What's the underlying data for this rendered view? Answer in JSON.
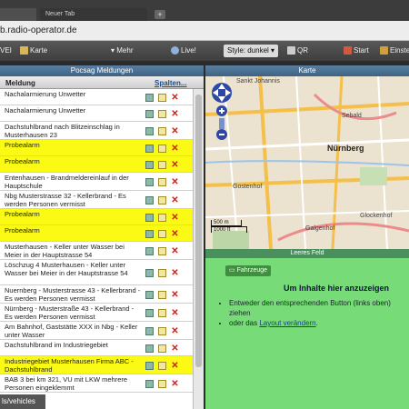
{
  "browser": {
    "tabs": [
      {
        "label": ""
      },
      {
        "label": "Neuer Tab"
      }
    ],
    "newtab_label": "+",
    "url": "b.radio-operator.de"
  },
  "toolbar": {
    "items": [
      "VEI",
      "Karte",
      "Mehr",
      "Live!",
      "Style: dunkel",
      "QR",
      "Start",
      "Einste"
    ],
    "chevron": "▾"
  },
  "panels": {
    "left_title": "Pocsag Meldungen",
    "right_title": "Karte",
    "empty_field_title": "Leeres Feld"
  },
  "table": {
    "col_meldung": "Meldung",
    "col_spalten": "Spalten...",
    "rows": [
      {
        "text": "Nachalarmierung Unwetter",
        "highlight": false
      },
      {
        "text": "Nachalarmierung Unwetter",
        "highlight": false
      },
      {
        "text": "Dachstuhlbrand nach Blitzeinschlag in Musterhausen 23",
        "highlight": false
      },
      {
        "text": "Probealarm",
        "highlight": true
      },
      {
        "text": "Probealarm",
        "highlight": true
      },
      {
        "text": "Entenhausen - Brandmeldereinlauf in der Hauptschule",
        "highlight": false
      },
      {
        "text": "Nbg Musterstrasse 32 - Kellerbrand - Es werden Personen vermisst",
        "highlight": false
      },
      {
        "text": "Probealarm",
        "highlight": true
      },
      {
        "text": "Probealarm",
        "highlight": true
      },
      {
        "text": "Musterhausen - Keller unter Wasser bei Meier in der Hauptstrasse 54",
        "highlight": false
      },
      {
        "text": "Löschzug 4 Musterhausen - Keller unter Wasser bei Meier in der Hauptstrasse 54",
        "highlight": false
      },
      {
        "text": "Nuernberg - Musterstrasse 43 - Kellerbrand - Es werden Personen vermisst",
        "highlight": false
      },
      {
        "text": "Nürnberg - Musterstraße 43 - Kellerbrand - Es werden Personen vermisst",
        "highlight": false
      },
      {
        "text": "Am Bahnhof, Gaststätte XXX in Nbg - Keller unter Wasser",
        "highlight": false
      },
      {
        "text": "Dachstuhlbrand im Industriegebiet",
        "highlight": false
      },
      {
        "text": "Industriegebiet Musterhausen Firma ABC - Dachstuhlbrand",
        "highlight": true
      },
      {
        "text": "BAB 3 bei km 321, VU mit LKW mehrere Personen eingeklemmt",
        "highlight": false
      }
    ]
  },
  "bottom_tab": "ls/vehicles",
  "map": {
    "labels": [
      "Sankt Johannis",
      "Sebald",
      "Nürnberg",
      "Gostenhof",
      "Galgenhof",
      "Glockenhof"
    ],
    "scale_m": "500 m",
    "scale_ft": "1000 ft"
  },
  "empty_field": {
    "button": "Fahrzeuge",
    "heading": "Um Inhalte hier anzuzeigen",
    "items": [
      "Entweder den entsprechenden Button (links oben) ziehen",
      "oder das "
    ],
    "link_text": "Layout verändern",
    "after_link": "."
  },
  "colors": {
    "highlight": "#fafa14",
    "normal_row": "#ffffff",
    "green": "#77dc77",
    "header_blue": "#3e6283"
  }
}
